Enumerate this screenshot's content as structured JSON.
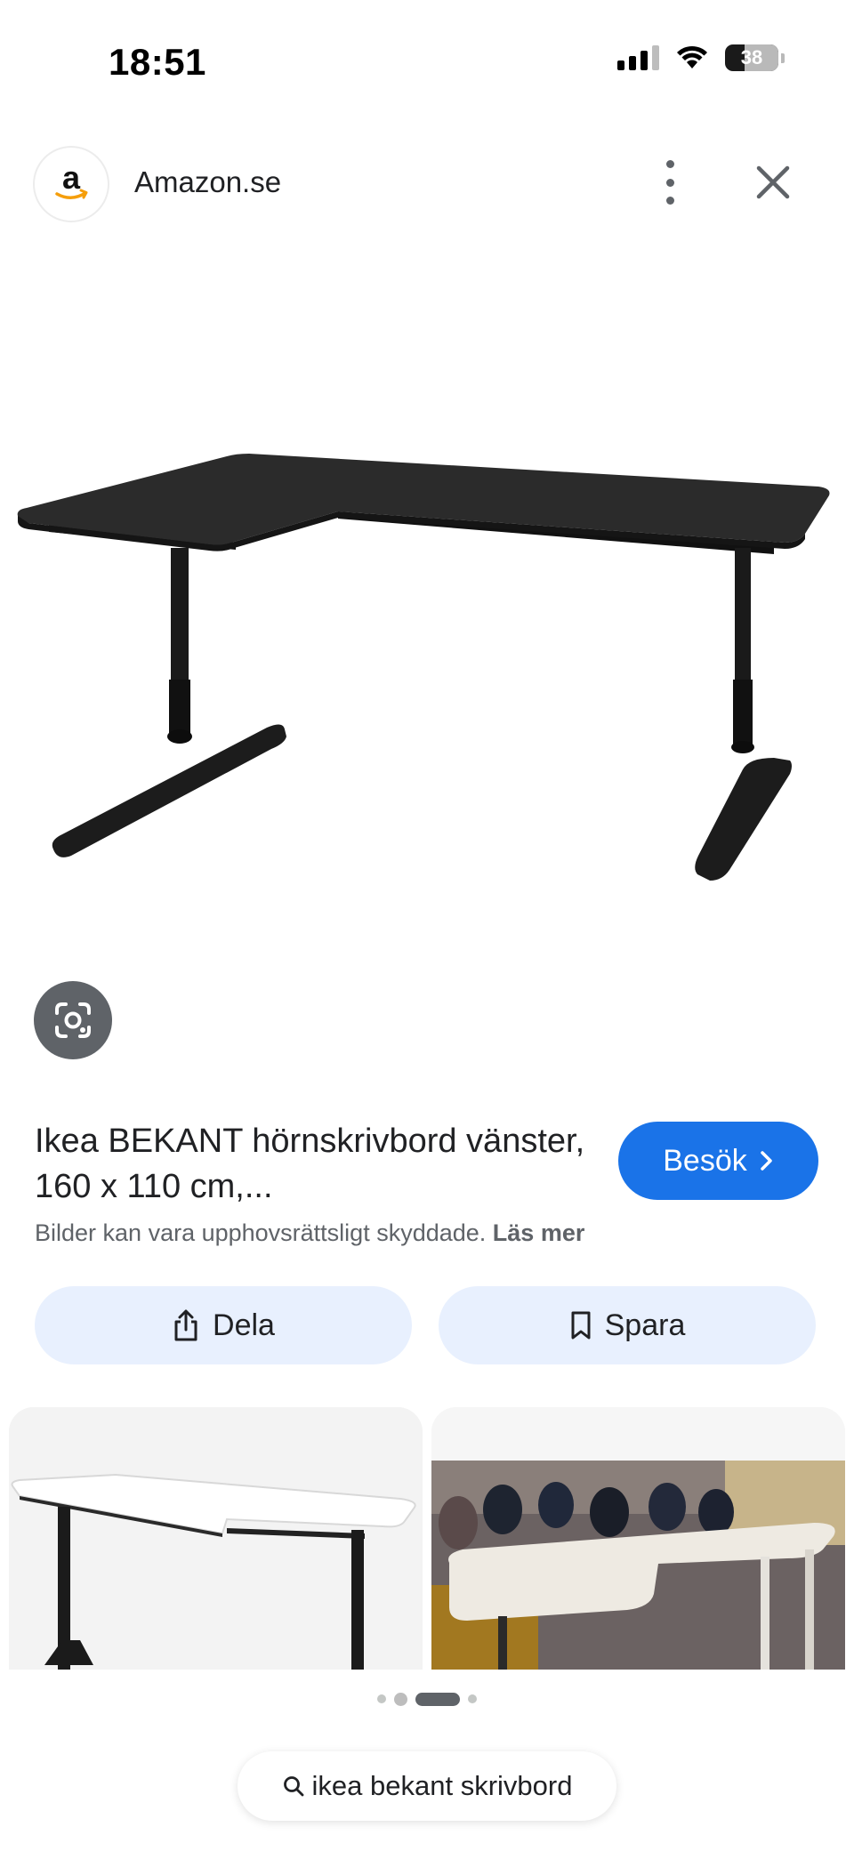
{
  "status_bar": {
    "time": "18:51",
    "battery": "38",
    "icons": [
      "cellular-signal-icon",
      "wifi-icon",
      "battery-icon"
    ]
  },
  "header": {
    "site_logo_letter": "a",
    "site_name": "Amazon.se",
    "icons": [
      "more-vertical-icon",
      "close-icon"
    ]
  },
  "product": {
    "title": "Ikea BEKANT hörnskrivbord vänster, 160 x 110 cm,...",
    "visit_label": "Besök",
    "copyright_text": "Bilder kan vara upphovsrättsligt skyddade.",
    "read_more": "Läs mer"
  },
  "actions": {
    "share_label": "Dela",
    "save_label": "Spara"
  },
  "pagination": {
    "dots": 4,
    "active_index": 2
  },
  "search": {
    "query": "ikea bekant skrivbord"
  },
  "colors": {
    "accent_blue": "#1a73e8",
    "action_bg": "#e8f0fe",
    "lens_bg": "#5f6368",
    "text_primary": "#202124",
    "text_secondary": "#5f6368"
  }
}
